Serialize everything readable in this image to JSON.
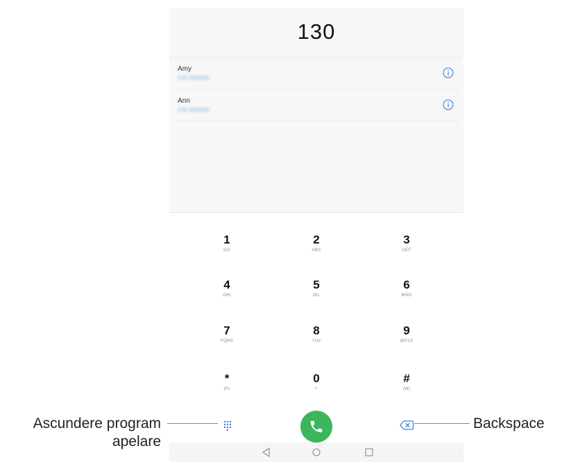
{
  "dialer": {
    "number": "130",
    "contacts": [
      {
        "name": "Amy",
        "number": "130 0000000"
      },
      {
        "name": "Ann",
        "number": "130 0000000"
      }
    ],
    "keys": [
      {
        "digit": "1",
        "letters": "GO"
      },
      {
        "digit": "2",
        "letters": "ABC"
      },
      {
        "digit": "3",
        "letters": "DEF"
      },
      {
        "digit": "4",
        "letters": "GHI"
      },
      {
        "digit": "5",
        "letters": "JKL"
      },
      {
        "digit": "6",
        "letters": "MNO"
      },
      {
        "digit": "7",
        "letters": "PQRS"
      },
      {
        "digit": "8",
        "letters": "TUV"
      },
      {
        "digit": "9",
        "letters": "WXYZ"
      },
      {
        "digit": "*",
        "letters": "(P)"
      },
      {
        "digit": "0",
        "letters": "+"
      },
      {
        "digit": "#",
        "letters": "(W)"
      }
    ]
  },
  "callouts": {
    "left_line1": "Ascundere program",
    "left_line2": "apelare",
    "right": "Backspace"
  },
  "icons": {
    "info": "info-icon",
    "dialpad": "dialpad-grid-icon",
    "call": "phone-call-icon",
    "backspace": "backspace-icon",
    "nav_back": "triangle-back-icon",
    "nav_home": "circle-home-icon",
    "nav_recent": "square-recent-icon"
  },
  "colors": {
    "call_green": "#3cb55b",
    "accent_blue": "#4a90e2",
    "callout_line": "#28a8c6"
  }
}
